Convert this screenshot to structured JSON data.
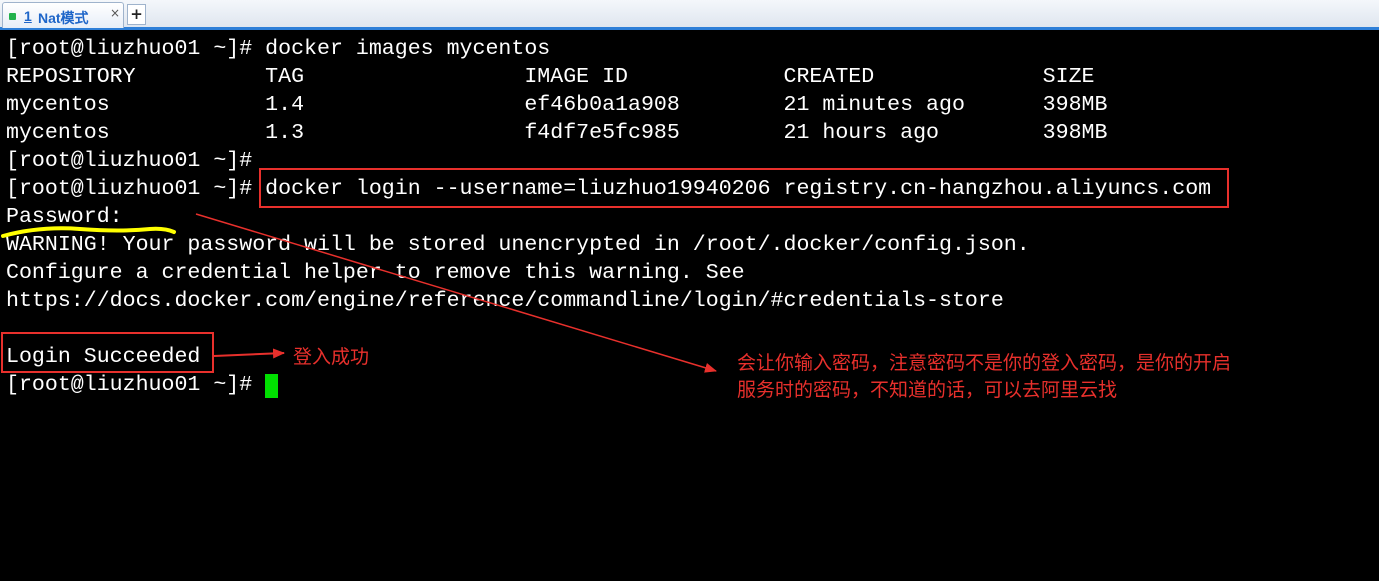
{
  "tab": {
    "number": "1",
    "label": "Nat模式",
    "close": "×",
    "new_tab": "+",
    "status_color": "#22b14c"
  },
  "terminal": {
    "lines": [
      "[root@liuzhuo01 ~]# docker images mycentos",
      "REPOSITORY          TAG                 IMAGE ID            CREATED             SIZE",
      "mycentos            1.4                 ef46b0a1a908        21 minutes ago      398MB",
      "mycentos            1.3                 f4df7e5fc985        21 hours ago        398MB",
      "[root@liuzhuo01 ~]#",
      "[root@liuzhuo01 ~]# docker login --username=liuzhuo19940206 registry.cn-hangzhou.aliyuncs.com",
      "Password:",
      "WARNING! Your password will be stored unencrypted in /root/.docker/config.json.",
      "Configure a credential helper to remove this warning. See",
      "https://docs.docker.com/engine/reference/commandline/login/#credentials-store",
      "",
      "Login Succeeded",
      "[root@liuzhuo01 ~]#"
    ],
    "cursor_color": "#00e000"
  },
  "annotations": {
    "login_success_note": "登入成功",
    "password_note_line1": "会让你输入密码，注意密码不是你的登入密码，是你的开启",
    "password_note_line2": "服务时的密码，不知道的话，可以去阿里云找",
    "annotation_color": "#e8302c",
    "highlight_color": "#ffff00"
  }
}
